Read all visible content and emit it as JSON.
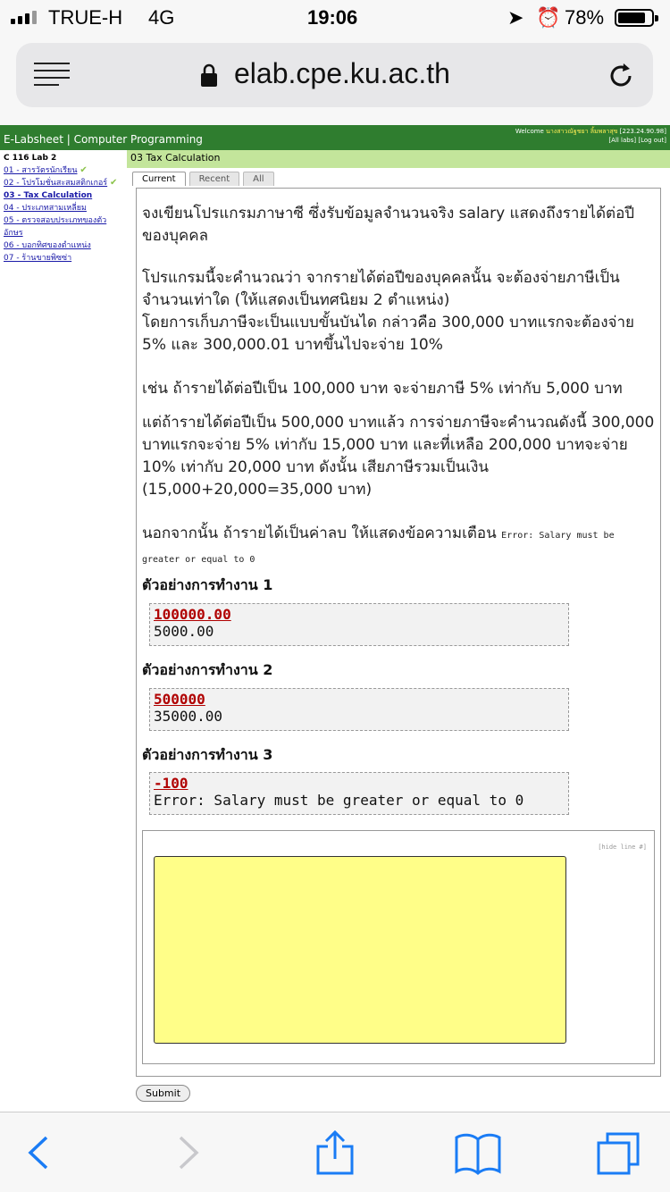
{
  "statusbar": {
    "carrier": "TRUE-H",
    "network": "4G",
    "time": "19:06",
    "battery": "78%"
  },
  "browser": {
    "url": "elab.cpe.ku.ac.th",
    "menu_icon": "menu-icon",
    "lock_icon": "lock-icon",
    "reload_icon": "reload-icon"
  },
  "site": {
    "title": "E-Labsheet | Computer Programming",
    "welcome_label": "Welcome",
    "user_name": "นางสาวณัฐชยา ลิ้มพลาสุข",
    "ip": "[223.24.90.98]",
    "links": "[All labs] [Log out]"
  },
  "sidebar": {
    "header": "C 116 Lab 2",
    "items": [
      {
        "label": "01 - สารวัตรนักเรียน",
        "done": "✔"
      },
      {
        "label": "02 - โปรโมชั่นสะสมสติกเกอร์",
        "done": "✔"
      },
      {
        "label": "03 - Tax Calculation"
      },
      {
        "label": "04 - ประเภทสามเหลี่ยม"
      },
      {
        "label": "05 - ตรวจสอบประเภทของตัวอักษร"
      },
      {
        "label": "06 - บอกทิศของตำแหน่ง"
      },
      {
        "label": "07 - ร้านขายพิซซ่า"
      }
    ]
  },
  "main": {
    "title": "03 Tax Calculation",
    "tabs": [
      "Current",
      "Recent",
      "All"
    ],
    "paragraphs": {
      "p1": "จงเขียนโปรแกรมภาษาซี ซึ่งรับข้อมูลจำนวนจริง salary แสดงถึงรายได้ต่อปีของบุคคล",
      "p2": "โปรแกรมนี้จะคำนวณว่า จากรายได้ต่อปีของบุคคลนั้น จะต้องจ่ายภาษีเป็นจำนวนเท่าใด (ให้แสดงเป็นทศนิยม 2 ตำแหน่ง)",
      "p3": "โดยการเก็บภาษีจะเป็นแบบขั้นบันได กล่าวคือ 300,000 บาทแรกจะต้องจ่าย 5% และ 300,000.01 บาทขึ้นไปจะจ่าย 10%",
      "p4": "เช่น ถ้ารายได้ต่อปีเป็น 100,000 บาท จะจ่ายภาษี 5% เท่ากับ 5,000 บาท",
      "p5": "แต่ถ้ารายได้ต่อปีเป็น 500,000 บาทแล้ว การจ่ายภาษีจะคำนวณดังนี้ 300,000 บาทแรกจะจ่าย 5% เท่ากับ 15,000 บาท และที่เหลือ 200,000 บาทจะจ่าย 10% เท่ากับ 20,000 บาท ดังนั้น เสียภาษีรวมเป็นเงิน (15,000+20,000=35,000 บาท)",
      "p6": "นอกจากนั้น ถ้ารายได้เป็นค่าลบ ให้แสดงข้อความเตือน",
      "p6_code": "Error: Salary must be greater or equal to 0"
    },
    "examples": [
      {
        "heading": "ตัวอย่างการทำงาน 1",
        "input": "100000.00",
        "output": "5000.00"
      },
      {
        "heading": "ตัวอย่างการทำงาน 2",
        "input": "500000",
        "output": "35000.00"
      },
      {
        "heading": "ตัวอย่างการทำงาน 3",
        "input": "-100",
        "output": "Error: Salary must be greater or equal to 0"
      }
    ],
    "hide_line": "[hide line #]",
    "submit": "Submit"
  },
  "toolbar": {
    "icons": [
      "back-icon",
      "forward-icon",
      "share-icon",
      "bookmarks-icon",
      "tabs-icon"
    ]
  }
}
